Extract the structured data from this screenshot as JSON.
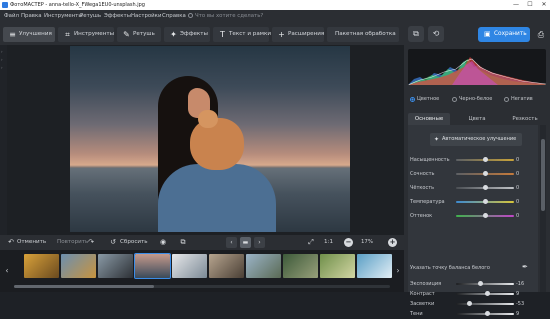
{
  "window": {
    "title": "ФотоМАСТЕР - anna-tello-X_FWega1EU0-unsplash.jpg",
    "minimize": "—",
    "maximize": "☐",
    "close": "✕"
  },
  "menu": {
    "items": [
      "Файл",
      "Правка",
      "Инструменты",
      "Ретушь",
      "Эффекты",
      "Настройки",
      "Справка"
    ],
    "search_placeholder": "Что вы хотите сделать?"
  },
  "toolbar": {
    "tabs": [
      {
        "label": "Улучшения",
        "icon": "sliders-icon",
        "active": true
      },
      {
        "label": "Инструменты",
        "icon": "crop-icon"
      },
      {
        "label": "Ретушь",
        "icon": "brush-icon"
      },
      {
        "label": "Эффекты",
        "icon": "sparkle-icon"
      },
      {
        "label": "Текст и рамки",
        "icon": "text-icon"
      },
      {
        "label": "Расширения",
        "icon": "plus-icon"
      },
      {
        "label": "Пакетная обработка",
        "icon": ""
      }
    ],
    "save_label": "Сохранить",
    "accent_color": "#2f86e4"
  },
  "bottombar": {
    "undo_label": "Отменить",
    "redo_label": "Повторить",
    "reset_label": "Сбросить",
    "zoom_fit_label": "1:1",
    "zoom_value": "17%"
  },
  "filmstrip": {
    "selected_index": 4,
    "thumbnail_count": 11
  },
  "panel": {
    "modes": [
      {
        "label": "Цветное",
        "checked": true
      },
      {
        "label": "Черно-белое",
        "checked": false
      },
      {
        "label": "Негатив",
        "checked": false
      }
    ],
    "tabs": [
      {
        "label": "Основные",
        "active": true
      },
      {
        "label": "Цвета",
        "active": false
      },
      {
        "label": "Резкость",
        "active": false
      }
    ],
    "auto_button": "Автоматическое улучшение",
    "sliders_top": [
      {
        "label": "Насыщенность",
        "value": "0",
        "level": 0.5,
        "track": "linear-gradient(90deg,#5b5f64,#c9a33a)"
      },
      {
        "label": "Сочность",
        "value": "0",
        "level": 0.5,
        "track": "linear-gradient(90deg,#5b5f64,#c57a3b)"
      },
      {
        "label": "Чёткость",
        "value": "0",
        "level": 0.5,
        "track": "linear-gradient(90deg,#4a4e53,#bfc2c6)"
      },
      {
        "label": "Температура",
        "value": "0",
        "level": 0.5,
        "track": "linear-gradient(90deg,#3c8ad1,#d7c53a)"
      },
      {
        "label": "Оттенок",
        "value": "0",
        "level": 0.5,
        "track": "linear-gradient(90deg,#3fb24c,#c144c8)"
      }
    ],
    "white_balance_label": "Указать точку баланса белого",
    "sliders_bottom": [
      {
        "label": "Экспозиция",
        "value": "-16",
        "level": 0.42,
        "track": "linear-gradient(90deg,#1d1f22,#e8eaed)"
      },
      {
        "label": "Контраст",
        "value": "9",
        "level": 0.55,
        "track": "linear-gradient(90deg,#1d1f22,#e8eaed)"
      },
      {
        "label": "Засветки",
        "value": "-53",
        "level": 0.24,
        "track": "linear-gradient(90deg,#1d1f22,#e8eaed)"
      },
      {
        "label": "Тени",
        "value": "9",
        "level": 0.55,
        "track": "linear-gradient(90deg,#1d1f22,#e8eaed)"
      }
    ]
  }
}
